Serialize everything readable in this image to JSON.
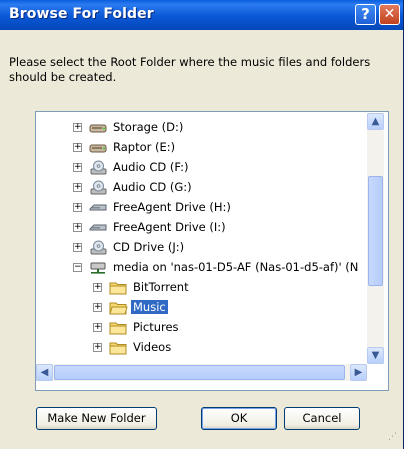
{
  "window": {
    "title": "Browse For Folder",
    "help_label": "?",
    "close_label": "✕"
  },
  "prompt": "Please select the Root Folder where the music files and folders should be created.",
  "tree": {
    "items": [
      {
        "label": "Storage (D:)",
        "icon": "hard-drive-icon",
        "expander": "+"
      },
      {
        "label": "Raptor (E:)",
        "icon": "hard-drive-icon",
        "expander": "+"
      },
      {
        "label": "Audio CD (F:)",
        "icon": "cd-drive-icon",
        "expander": "+"
      },
      {
        "label": "Audio CD (G:)",
        "icon": "cd-drive-icon",
        "expander": "+"
      },
      {
        "label": "FreeAgent Drive (H:)",
        "icon": "removable-drive-icon",
        "expander": "+"
      },
      {
        "label": "FreeAgent Drive (I:)",
        "icon": "removable-drive-icon",
        "expander": "+"
      },
      {
        "label": "CD Drive (J:)",
        "icon": "cd-drive-icon",
        "expander": "+"
      },
      {
        "label": "media on 'nas-01-D5-AF (Nas-01-d5-af)' (N",
        "icon": "network-drive-icon",
        "expander": "−"
      },
      {
        "label": "BitTorrent",
        "icon": "folder-icon",
        "expander": "+"
      },
      {
        "label": "Music",
        "icon": "folder-icon",
        "expander": "+",
        "selected": true
      },
      {
        "label": "Pictures",
        "icon": "folder-icon",
        "expander": "+"
      },
      {
        "label": "Videos",
        "icon": "folder-icon",
        "expander": "+"
      }
    ]
  },
  "scroll": {
    "up": "▲",
    "down": "▼",
    "left": "◀",
    "right": "▶"
  },
  "buttons": {
    "new_folder": "Make New Folder",
    "ok": "OK",
    "cancel": "Cancel"
  }
}
